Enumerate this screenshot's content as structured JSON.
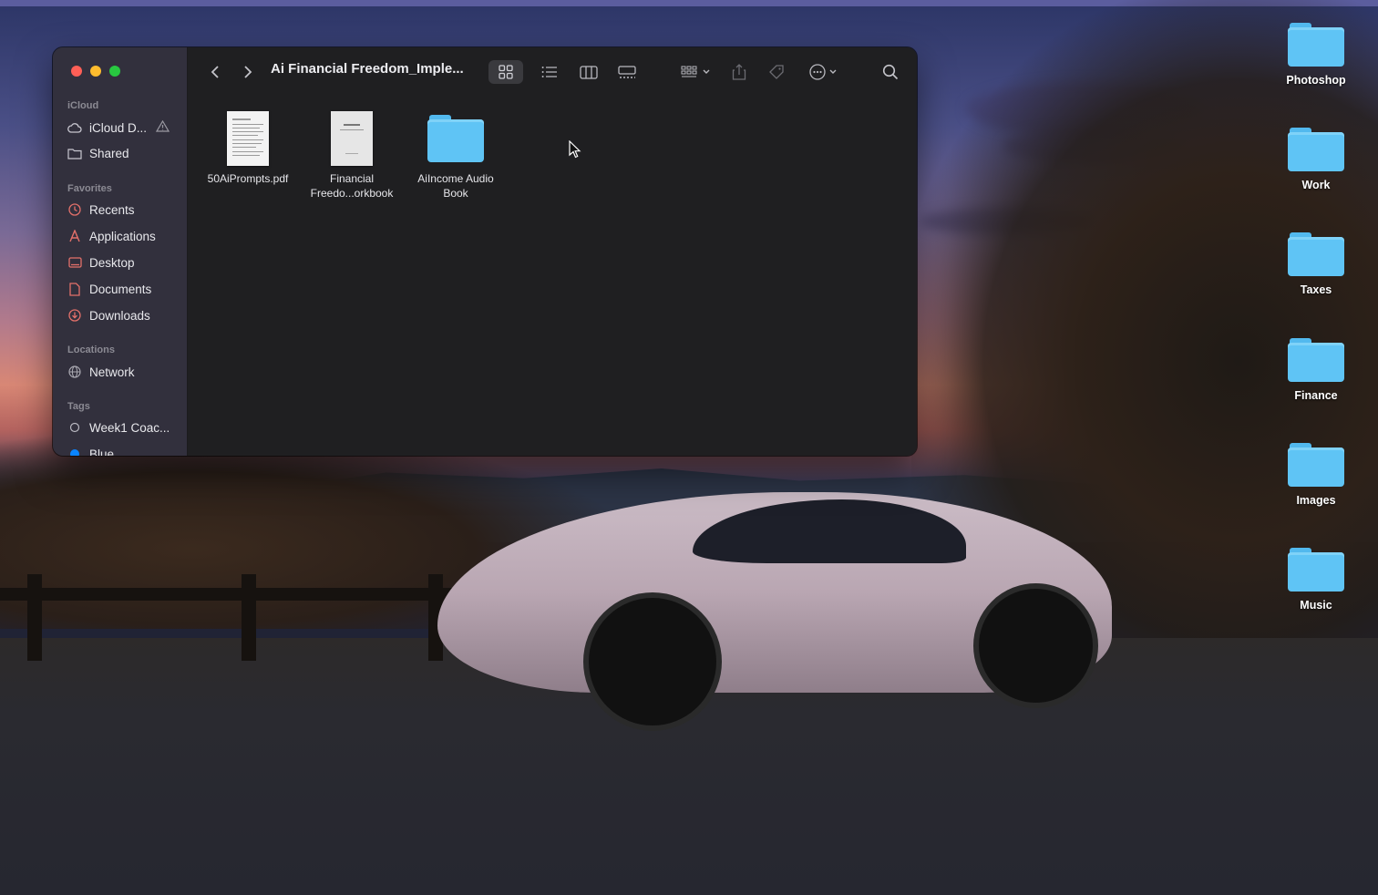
{
  "finder": {
    "window_title": "Ai Financial Freedom_Imple...",
    "sidebar": {
      "sections": [
        {
          "label": "iCloud",
          "items": [
            {
              "label": "iCloud D...",
              "icon": "cloud-icon"
            },
            {
              "label": "Shared",
              "icon": "shared-folder-icon"
            }
          ]
        },
        {
          "label": "Favorites",
          "items": [
            {
              "label": "Recents",
              "icon": "clock-icon"
            },
            {
              "label": "Applications",
              "icon": "applications-icon"
            },
            {
              "label": "Desktop",
              "icon": "desktop-icon"
            },
            {
              "label": "Documents",
              "icon": "document-icon"
            },
            {
              "label": "Downloads",
              "icon": "download-icon"
            }
          ]
        },
        {
          "label": "Locations",
          "items": [
            {
              "label": "Network",
              "icon": "globe-icon"
            }
          ]
        },
        {
          "label": "Tags",
          "items": [
            {
              "label": "Week1 Coac...",
              "icon": "tag-circle-icon"
            },
            {
              "label": "Blue",
              "icon": "tag-blue-dot-icon"
            }
          ]
        }
      ]
    },
    "files": [
      {
        "name": "50AiPrompts.pdf",
        "type": "pdf"
      },
      {
        "name_line1": "Financial",
        "name_line2": "Freedo...orkbook",
        "type": "document"
      },
      {
        "name_line1": "AiIncome Audio",
        "name_line2": "Book",
        "type": "folder"
      }
    ],
    "toolbar": {
      "icons": [
        "back-icon",
        "forward-icon",
        "icon-view-icon",
        "list-view-icon",
        "column-view-icon",
        "gallery-view-icon",
        "group-icon",
        "share-icon",
        "tag-icon",
        "more-icon",
        "search-icon"
      ],
      "active_view": "icon-view"
    }
  },
  "desktop": {
    "icons": [
      "Photoshop",
      "Work",
      "Taxes",
      "Finance",
      "Images",
      "Music"
    ]
  },
  "colors": {
    "folder": "#5fc4f5",
    "close": "#ff5f57",
    "minimize": "#febc2e",
    "zoom": "#28c840",
    "tag_blue": "#0a84ff"
  }
}
